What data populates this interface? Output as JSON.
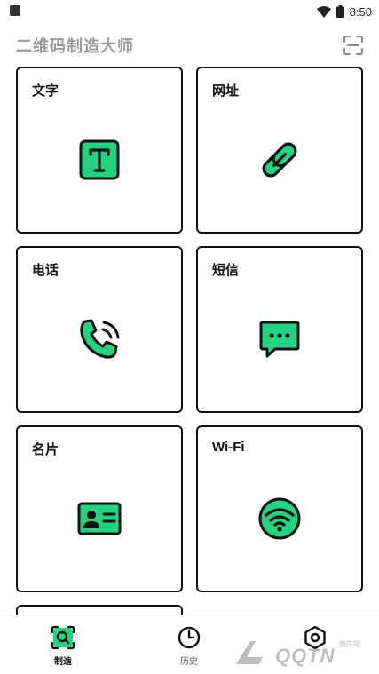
{
  "status_bar": {
    "time": "8:50",
    "notification_icon": "app-notification-icon",
    "wifi_icon": "wifi-signal-icon",
    "battery_icon": "battery-icon"
  },
  "header": {
    "title": "二维码制造大师",
    "scan_icon": "scan-icon"
  },
  "cards": [
    {
      "label": "文字",
      "icon": "text-icon"
    },
    {
      "label": "网址",
      "icon": "link-icon"
    },
    {
      "label": "电话",
      "icon": "phone-icon"
    },
    {
      "label": "短信",
      "icon": "sms-icon"
    },
    {
      "label": "名片",
      "icon": "contact-card-icon"
    },
    {
      "label": "Wi-Fi",
      "icon": "wifi-icon"
    }
  ],
  "bottom_nav": [
    {
      "label": "制造",
      "icon": "create-icon",
      "active": true
    },
    {
      "label": "历史",
      "icon": "history-icon",
      "active": false
    },
    {
      "label": "",
      "icon": "settings-icon",
      "active": false
    }
  ],
  "watermark": {
    "text": "QQTN",
    "small": "腾牛网"
  },
  "colors": {
    "accent": "#22d37f",
    "outline": "#111111",
    "title_gray": "#9a9a9a"
  }
}
